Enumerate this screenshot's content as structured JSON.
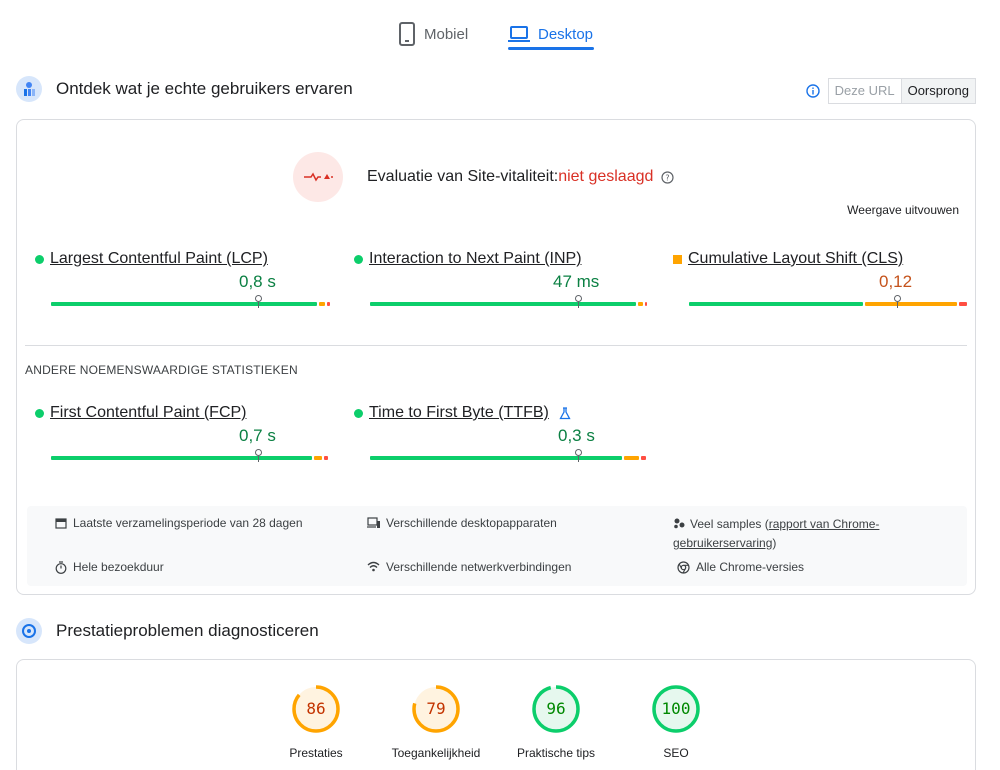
{
  "tabs": [
    {
      "label": "Mobiel",
      "icon": "phone-icon",
      "active": false
    },
    {
      "label": "Desktop",
      "icon": "laptop-icon",
      "active": true
    }
  ],
  "field_section": {
    "title": "Ontdek wat je echte gebruikers ervaren",
    "toggle": {
      "this_url": "Deze URL",
      "origin": "Oorsprong"
    },
    "assessment": {
      "prefix": "Evaluatie van Site-vitaliteit:",
      "result": "niet geslaagd",
      "result_color": "#d93025"
    },
    "expand_label": "Weergave uitvouwen",
    "core_metrics": [
      {
        "label": "Largest Contentful Paint (LCP)",
        "value": "0,8 s",
        "status": "good"
      },
      {
        "label": "Interaction to Next Paint (INP)",
        "value": "47 ms",
        "status": "good"
      },
      {
        "label": "Cumulative Layout Shift (CLS)",
        "value": "0,12",
        "status": "average"
      }
    ],
    "other_title": "ANDERE NOEMENSWAARDIGE STATISTIEKEN",
    "other_metrics": [
      {
        "label": "First Contentful Paint (FCP)",
        "value": "0,7 s",
        "status": "good"
      },
      {
        "label": "Time to First Byte (TTFB)",
        "value": "0,3 s",
        "status": "good",
        "experimental_icon": "flask-icon"
      }
    ],
    "info": {
      "period": "Laatste verzamelingsperiode van 28 dagen",
      "devices": "Verschillende desktopapparaten",
      "samples_prefix": "Veel samples (",
      "samples_link": "rapport van Chrome-gebruikerservaring",
      "samples_suffix": ")",
      "duration": "Hele bezoekduur",
      "network": "Verschillende netwerkverbindingen",
      "chrome": "Alle Chrome-versies"
    }
  },
  "lab_section": {
    "title": "Prestatieproblemen diagnosticeren",
    "scores": [
      {
        "label": "Prestaties",
        "score": "86",
        "fraction": 0.86,
        "color": "#ffa400",
        "text_color": "#c33300",
        "bg": "#fff3e0"
      },
      {
        "label": "Toegankelijkheid",
        "score": "79",
        "fraction": 0.79,
        "color": "#ffa400",
        "text_color": "#c33300",
        "bg": "#fff3e0"
      },
      {
        "label": "Praktische tips",
        "score": "96",
        "fraction": 0.96,
        "color": "#0cce6b",
        "text_color": "#008800",
        "bg": "#e6f8ee"
      },
      {
        "label": "SEO",
        "score": "100",
        "fraction": 1.0,
        "color": "#0cce6b",
        "text_color": "#008800",
        "bg": "#e6f8ee"
      }
    ]
  },
  "colors": {
    "good": "#0cce6b",
    "average": "#ffa400",
    "poor": "#ff4e42",
    "accent": "#1a73e8"
  }
}
